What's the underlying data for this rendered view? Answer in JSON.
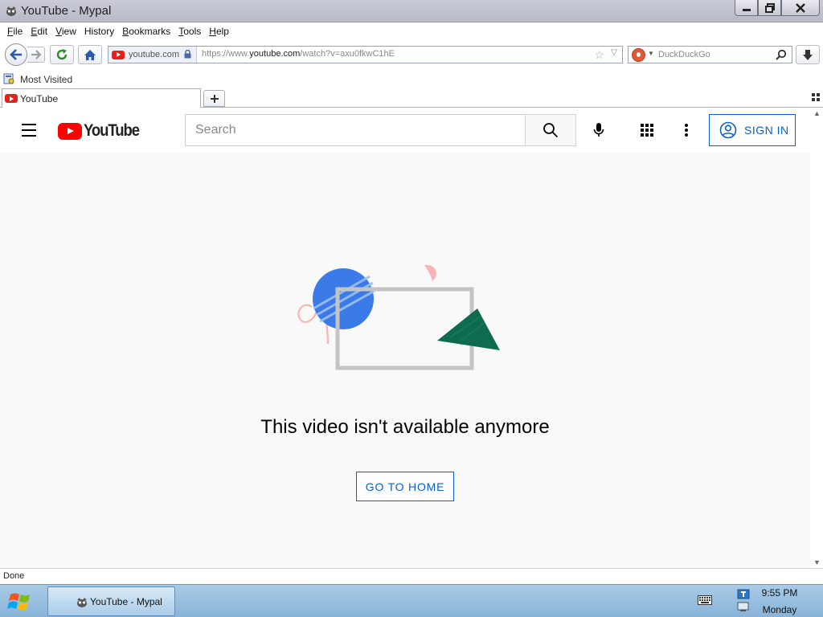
{
  "window": {
    "title": "YouTube - Mypal",
    "buttons": {
      "minimize": "minimize",
      "maximize": "restore",
      "close": "close"
    }
  },
  "menu": [
    {
      "label": "File",
      "mnemonic": "F",
      "rest": "ile"
    },
    {
      "label": "Edit",
      "mnemonic": "E",
      "rest": "dit"
    },
    {
      "label": "View",
      "mnemonic": "V",
      "rest": "iew"
    },
    {
      "label": "History",
      "mnemonic": "",
      "rest": "History"
    },
    {
      "label": "Bookmarks",
      "mnemonic": "B",
      "rest": "ookmarks"
    },
    {
      "label": "Tools",
      "mnemonic": "T",
      "rest": "ools"
    },
    {
      "label": "Help",
      "mnemonic": "H",
      "rest": "elp"
    }
  ],
  "navbar": {
    "identity_domain": "youtube.com",
    "url_prefix": "https://www.",
    "url_host": "youtube.com",
    "url_path": "/watch?v=axu0fkwC1hE",
    "search_engine_placeholder": "DuckDuckGo"
  },
  "bookmarks": {
    "most_visited": "Most Visited"
  },
  "tabs": [
    {
      "title": "YouTube",
      "active": true
    }
  ],
  "youtube": {
    "logo_text": "YouTube",
    "search_placeholder": "Search",
    "sign_in": "SIGN IN",
    "message": "This video isn't available anymore",
    "go_home": "GO TO HOME"
  },
  "status": {
    "text": "Done"
  },
  "taskbar": {
    "active_window": "YouTube - Mypal",
    "time": "9:55 PM",
    "day": "Monday"
  },
  "colors": {
    "youtube_red": "#ff0000",
    "link_blue": "#065fd4",
    "illustration_blue": "#3b7be8",
    "illustration_green": "#0f6b4f",
    "illustration_pink": "#f7b5b5",
    "illustration_frame": "#c4c4c4"
  },
  "icons": [
    "app-icon",
    "back-icon",
    "forward-icon",
    "reload-icon",
    "home-icon",
    "lock-icon",
    "bookmark-star-icon",
    "duckduckgo-icon",
    "search-icon",
    "download-icon",
    "most-visited-icon",
    "new-tab-icon",
    "hamburger-icon",
    "mic-icon",
    "apps-icon",
    "more-vert-icon",
    "account-icon",
    "windows-start-icon",
    "keyboard-icon",
    "network-icon"
  ]
}
